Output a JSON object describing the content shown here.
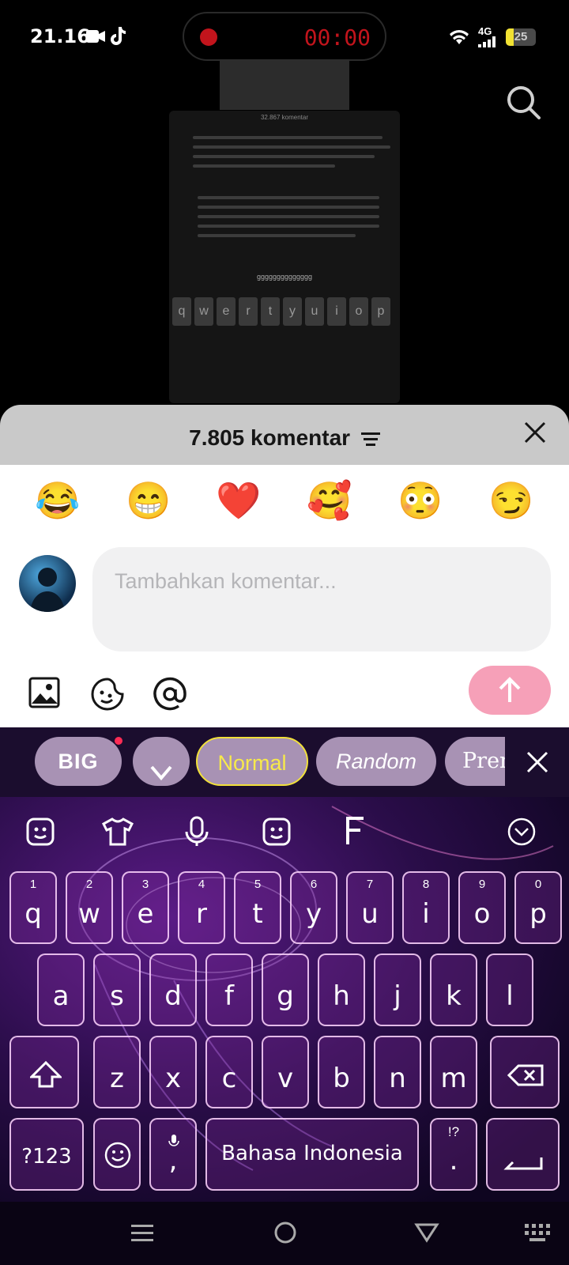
{
  "status": {
    "time": "21.16",
    "network": "4G",
    "battery": "25",
    "recording_time": "00:00"
  },
  "colors": {
    "accent": "#fe2c55",
    "send_disabled": "#f6a0b8",
    "sheet_header": "#c9c9c9",
    "record_red": "#c2141c"
  },
  "sheet": {
    "title": "7.805 komentar"
  },
  "emoji_bar": [
    "😂",
    "😁",
    "❤️",
    "🥰",
    "😳",
    "😏"
  ],
  "comment_input": {
    "placeholder": "Tambahkan komentar..."
  },
  "keyboard": {
    "toolbar_chips": [
      "BIG",
      "Normal",
      "Random",
      "Prem"
    ],
    "row1": [
      [
        "q",
        "1"
      ],
      [
        "w",
        "2"
      ],
      [
        "e",
        "3"
      ],
      [
        "r",
        "4"
      ],
      [
        "t",
        "5"
      ],
      [
        "y",
        "6"
      ],
      [
        "u",
        "7"
      ],
      [
        "i",
        "8"
      ],
      [
        "o",
        "9"
      ],
      [
        "p",
        "0"
      ]
    ],
    "row2": [
      "a",
      "s",
      "d",
      "f",
      "g",
      "h",
      "j",
      "k",
      "l"
    ],
    "row3": [
      "z",
      "x",
      "c",
      "v",
      "b",
      "n",
      "m"
    ],
    "symbols_key": "?123",
    "comma": ",",
    "period": ".",
    "period_hint": "!?",
    "space_label": "Bahasa Indonesia"
  },
  "background_thumb": {
    "comment_count": "32.867 komentar",
    "typed_text": "gggggggggggggg"
  }
}
